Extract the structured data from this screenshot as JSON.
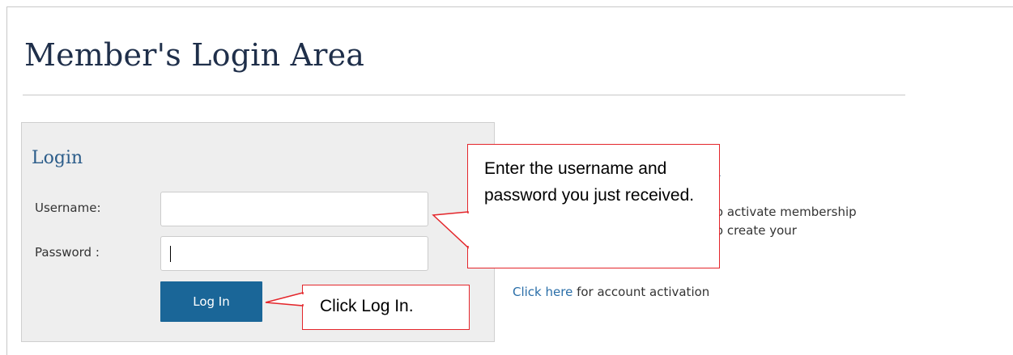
{
  "page": {
    "title": "Member's Login Area"
  },
  "login": {
    "heading": "Login",
    "username_label": "Username:",
    "username_value": "",
    "password_label": "Password :",
    "password_value": "",
    "button_label": "Log In"
  },
  "activation": {
    "heading_visible": "n",
    "text_visible": "to activate membership\nto create your",
    "link_text": "Click here",
    "link_suffix": " for account activation"
  },
  "callouts": {
    "credentials": "Enter the username and password you just received.",
    "login": "Click Log In."
  },
  "colors": {
    "title": "#1f2f4a",
    "heading": "#2c5d8a",
    "button": "#1a6698",
    "link": "#2a6ea8",
    "callout_border": "#e4262b",
    "panel_bg": "#eeeeee"
  }
}
